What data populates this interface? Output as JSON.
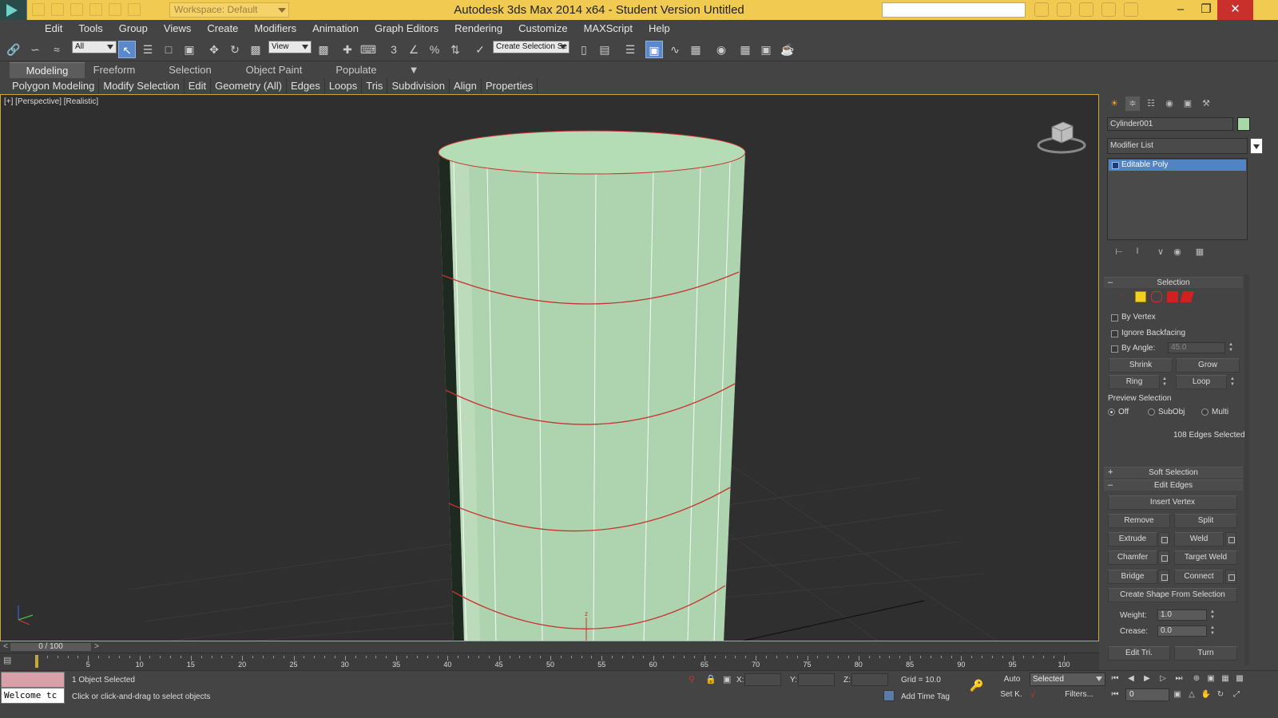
{
  "app": {
    "workspace": "Workspace: Default",
    "title": "Autodesk 3ds Max  2014 x64   - Student Version    Untitled",
    "window_controls": [
      "minimize",
      "maximize",
      "close"
    ]
  },
  "menu": [
    "Edit",
    "Tools",
    "Group",
    "Views",
    "Create",
    "Modifiers",
    "Animation",
    "Graph Editors",
    "Rendering",
    "Customize",
    "MAXScript",
    "Help"
  ],
  "toolbar": {
    "selection_filter": "All",
    "ref_coord": "View",
    "named_selection": "Create Selection Se"
  },
  "ribbon": {
    "tabs": [
      "Modeling",
      "Freeform",
      "Selection",
      "Object Paint",
      "Populate"
    ],
    "active_tab": "Modeling",
    "tools": [
      "Polygon Modeling",
      "Modify Selection",
      "Edit",
      "Geometry (All)",
      "Edges",
      "Loops",
      "Tris",
      "Subdivision",
      "Align",
      "Properties"
    ]
  },
  "viewport": {
    "label": "[+] [Perspective] [Realistic]",
    "object_color": "#aed4af",
    "edge_color": "#c83232",
    "axis_label": "z"
  },
  "command_panel": {
    "object_name": "Cylinder001",
    "object_color": "#a8d8a8",
    "modifier_list": "Modifier List",
    "stack": [
      "Editable Poly"
    ],
    "selection": {
      "title": "Selection",
      "by_vertex": "By Vertex",
      "ignore_backfacing": "Ignore Backfacing",
      "by_angle": "By Angle:",
      "angle_value": "45.0",
      "shrink": "Shrink",
      "grow": "Grow",
      "ring": "Ring",
      "loop": "Loop",
      "preview_title": "Preview Selection",
      "preview_off": "Off",
      "preview_subobj": "SubObj",
      "preview_multi": "Multi",
      "status": "108 Edges Selected"
    },
    "soft_selection": "Soft Selection",
    "edit_edges": {
      "title": "Edit Edges",
      "insert_vertex": "Insert Vertex",
      "remove": "Remove",
      "split": "Split",
      "extrude": "Extrude",
      "weld": "Weld",
      "chamfer": "Chamfer",
      "target_weld": "Target Weld",
      "bridge": "Bridge",
      "connect": "Connect",
      "create_shape": "Create Shape From Selection",
      "weight_label": "Weight:",
      "weight_value": "1.0",
      "crease_label": "Crease:",
      "crease_value": "0.0",
      "edit_tri": "Edit Tri.",
      "turn": "Turn"
    }
  },
  "timeline": {
    "slider_text": "0 / 100",
    "ticks": [
      "5",
      "10",
      "15",
      "20",
      "25",
      "30",
      "35",
      "40",
      "45",
      "50",
      "55",
      "60",
      "65",
      "70",
      "75",
      "80",
      "85",
      "90",
      "95",
      "100"
    ]
  },
  "status": {
    "maxscript_text": "Welcome tc",
    "selected_text": "1 Object Selected",
    "prompt": "Click or click-and-drag to select objects",
    "x_label": "X:",
    "y_label": "Y:",
    "z_label": "Z:",
    "grid": "Grid = 10.0",
    "add_time_tag": "Add Time Tag",
    "auto": "Auto",
    "set_key": "Set K.",
    "key_filter": "Selected",
    "filters": "Filters...",
    "frame": "0"
  }
}
